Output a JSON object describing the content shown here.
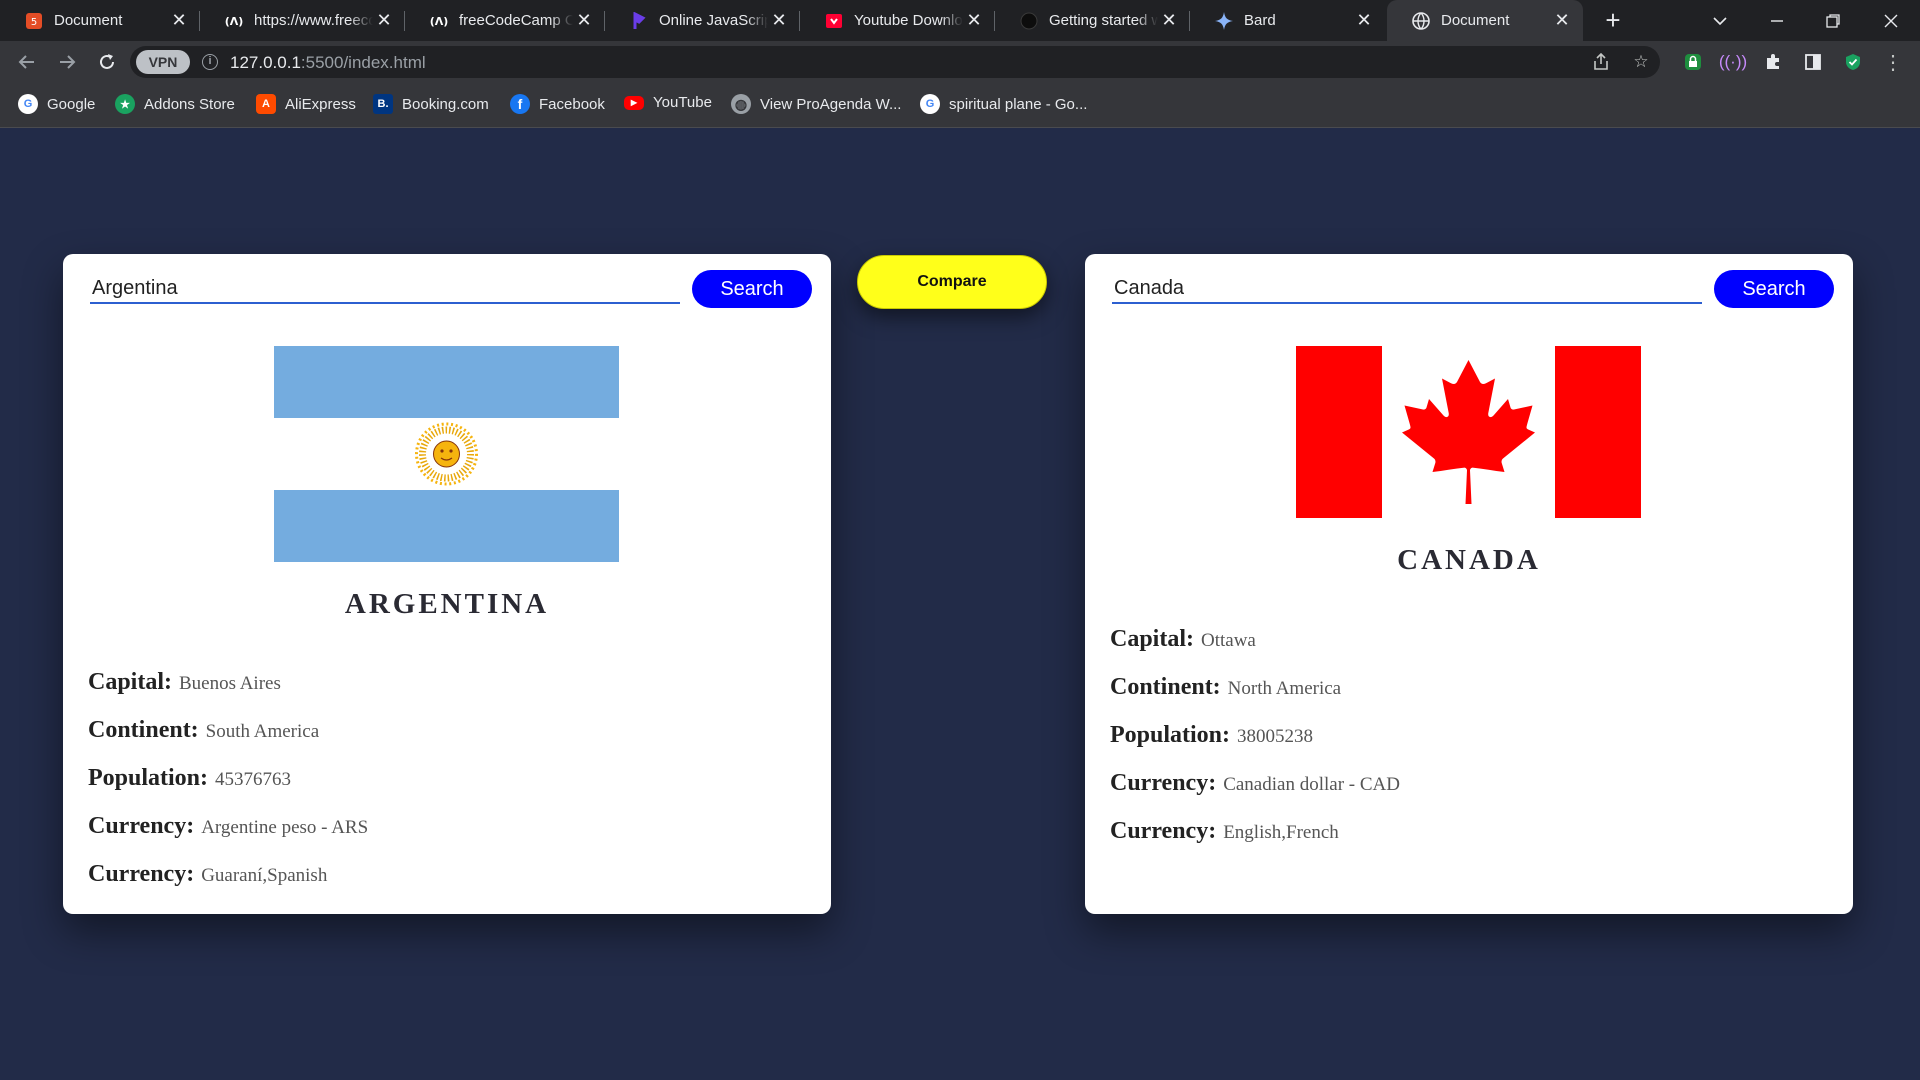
{
  "browser": {
    "tabs": [
      {
        "title": "Document",
        "favicon": "html-icon",
        "color": "#e44d26"
      },
      {
        "title": "https://www.freecodecamp.org",
        "favicon": "freecodecamp-icon",
        "color": "#ffffff"
      },
      {
        "title": "freeCodeCamp Challenges",
        "favicon": "freecodecamp-icon",
        "color": "#ffffff"
      },
      {
        "title": "Online JavaScript",
        "favicon": "programiz-icon",
        "color": "#6a3de8"
      },
      {
        "title": "Youtube Downloader",
        "favicon": "youtube-downloader-icon",
        "color": "#ff0033"
      },
      {
        "title": "Getting started with",
        "favicon": "github-icon",
        "color": "#0d0d0d"
      },
      {
        "title": "Bard",
        "favicon": "bard-icon",
        "color": "#8ab4f8"
      },
      {
        "title": "Document",
        "favicon": "globe-icon",
        "color": "#e8eaed"
      }
    ],
    "active_tab": 7,
    "address": {
      "host": "127.0.0.1",
      "rest": ":5500/index.html"
    },
    "vpn_label": "VPN",
    "bookmarks": [
      {
        "label": "Google",
        "icon": "google-icon",
        "color": "#ffffff",
        "letter": "G"
      },
      {
        "label": "Addons Store",
        "icon": "addons-store-icon",
        "color": "#1aa260",
        "letter": "★"
      },
      {
        "label": "AliExpress",
        "icon": "aliexpress-icon",
        "color": "#ff4b00",
        "letter": "A"
      },
      {
        "label": "Booking.com",
        "icon": "booking-icon",
        "color": "#003580",
        "letter": "B."
      },
      {
        "label": "Facebook",
        "icon": "facebook-icon",
        "color": "#1877f2",
        "letter": "f"
      },
      {
        "label": "YouTube",
        "icon": "youtube-icon",
        "color": "#ff0000",
        "letter": "▶"
      },
      {
        "label": "View ProAgenda W...",
        "icon": "globe-icon",
        "color": "#9aa0a6",
        "letter": "◍"
      },
      {
        "label": "spiritual plane - Go...",
        "icon": "google-icon",
        "color": "#ffffff",
        "letter": "G"
      }
    ]
  },
  "compare_label": "Compare",
  "cards": {
    "left": {
      "search_value": "Argentina",
      "search_label": "Search",
      "country_name": "ARGENTINA",
      "rows": [
        {
          "label": "Capital:",
          "value": "Buenos Aires"
        },
        {
          "label": "Continent:",
          "value": "South America"
        },
        {
          "label": "Population:",
          "value": "45376763"
        },
        {
          "label": "Currency:",
          "value": "Argentine peso - ARS"
        },
        {
          "label": "Currency:",
          "value": "Guaraní,Spanish"
        }
      ]
    },
    "right": {
      "search_value": "Canada",
      "search_label": "Search",
      "country_name": "CANADA",
      "rows": [
        {
          "label": "Capital:",
          "value": "Ottawa"
        },
        {
          "label": "Continent:",
          "value": "North America"
        },
        {
          "label": "Population:",
          "value": "38005238"
        },
        {
          "label": "Currency:",
          "value": "Canadian dollar - CAD"
        },
        {
          "label": "Currency:",
          "value": "English,French"
        }
      ]
    }
  },
  "colors": {
    "page_background": "#222b48",
    "search_button": "#0000ff",
    "compare_button": "#ffff1a",
    "argentina_blue": "#74acdf",
    "argentina_sun": "#f6b40e",
    "canada_red": "#ff0000"
  }
}
